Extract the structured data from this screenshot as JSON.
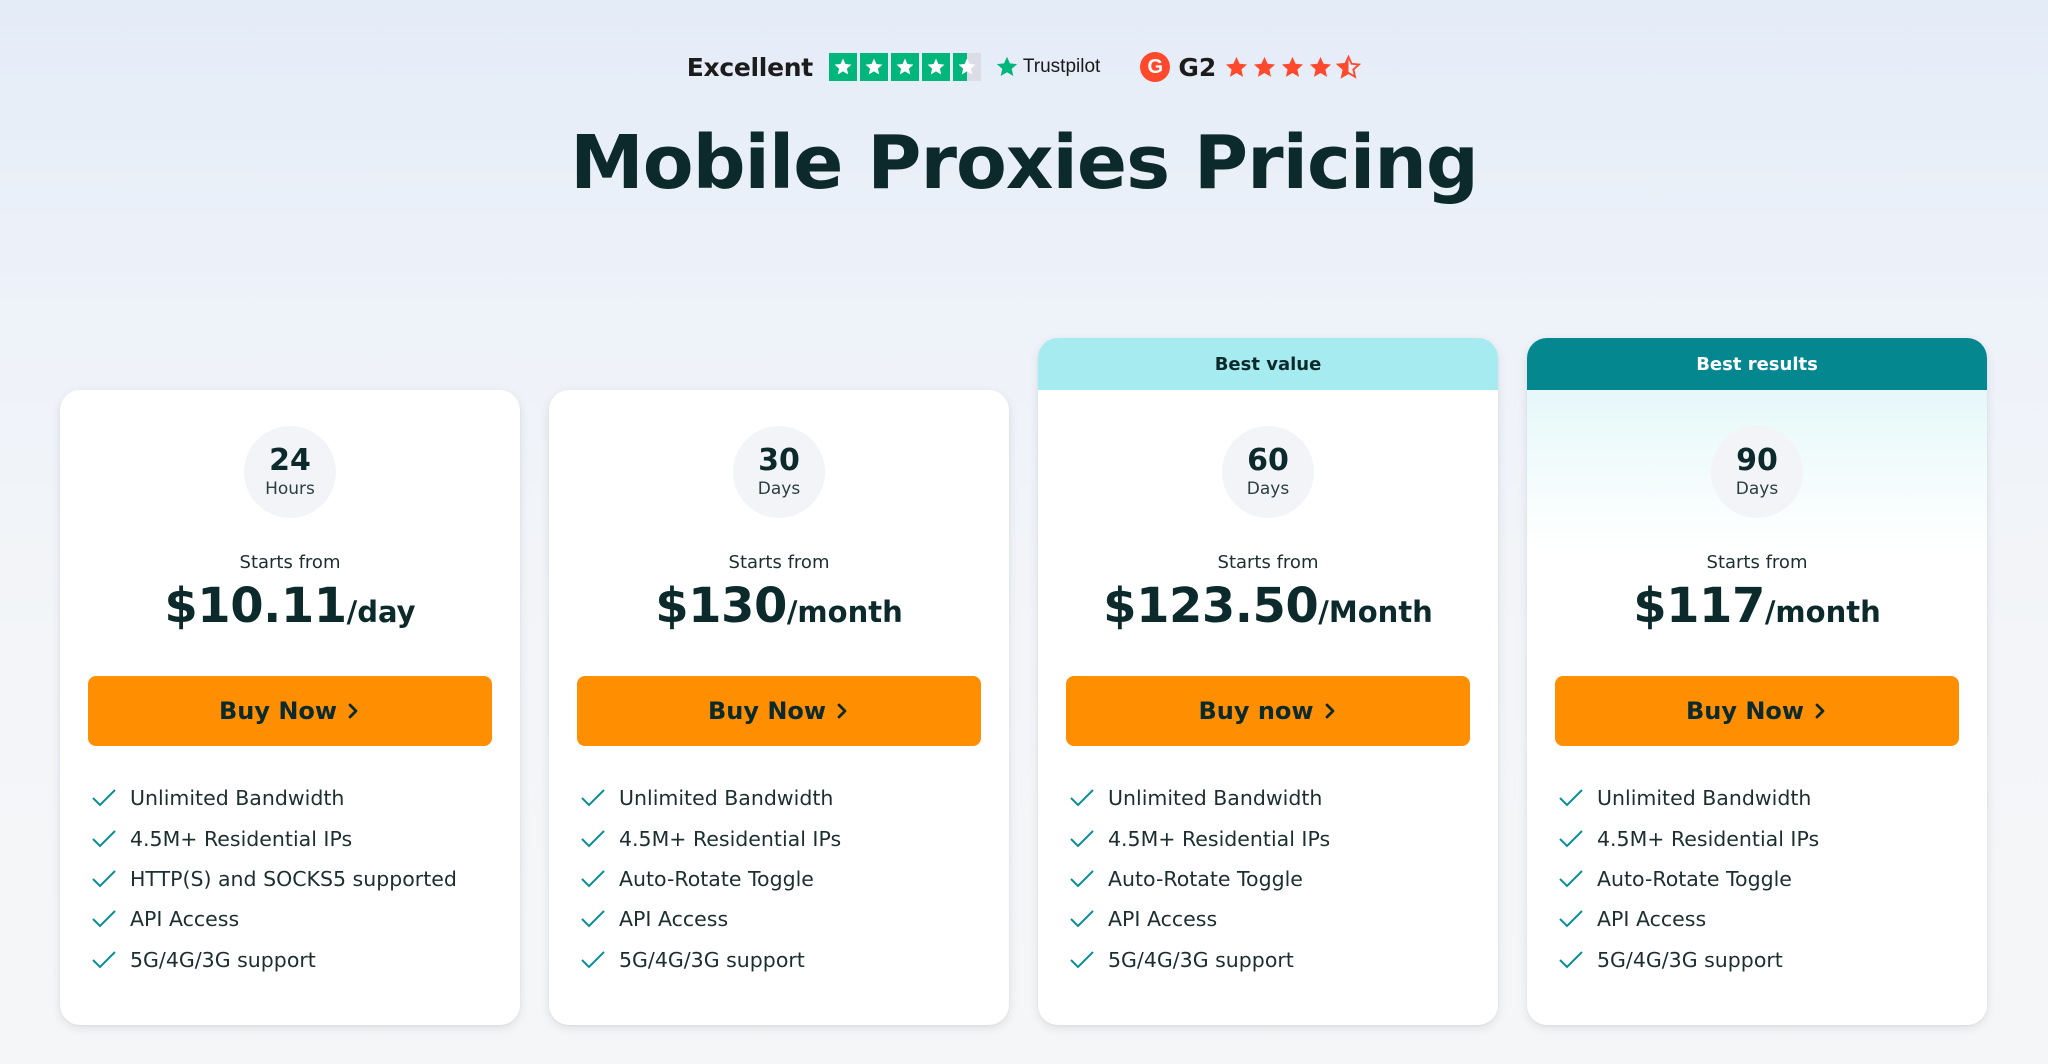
{
  "ratings": {
    "trustpilot_label": "Excellent",
    "trustpilot_brand": "Trustpilot",
    "trustpilot_stars": 4.5,
    "g2_brand": "G2",
    "g2_logo_letter": "G",
    "g2_stars": 4.5
  },
  "title": "Mobile Proxies Pricing",
  "colors": {
    "accent_button": "#ff8f00",
    "best_value_tag": "#a6ebf0",
    "best_results_tag": "#04878f",
    "check": "#0b8e97",
    "trustpilot_green": "#00b67a",
    "g2_red": "#ff492c"
  },
  "plans": [
    {
      "tag": "",
      "duration_value": "24",
      "duration_unit": "Hours",
      "starts_label": "Starts from",
      "price": "$10.11",
      "period": "/day",
      "cta": "Buy Now",
      "cta_icon": "chevron-right-icon",
      "features": [
        "Unlimited Bandwidth",
        "4.5M+ Residential IPs",
        "HTTP(S) and SOCKS5 supported",
        "API Access",
        "5G/4G/3G support"
      ]
    },
    {
      "tag": "",
      "duration_value": "30",
      "duration_unit": "Days",
      "starts_label": "Starts from",
      "price": "$130",
      "period": "/month",
      "cta": "Buy Now",
      "cta_icon": "chevron-right-icon",
      "features": [
        "Unlimited Bandwidth",
        "4.5M+ Residential IPs",
        "Auto-Rotate Toggle",
        "API Access",
        "5G/4G/3G support"
      ]
    },
    {
      "tag": "Best value",
      "duration_value": "60",
      "duration_unit": "Days",
      "starts_label": "Starts from",
      "price": "$123.50",
      "period": "/Month",
      "cta": "Buy now",
      "cta_icon": "chevron-right-icon",
      "features": [
        "Unlimited Bandwidth",
        "4.5M+ Residential IPs",
        "Auto-Rotate Toggle",
        "API Access",
        "5G/4G/3G support"
      ]
    },
    {
      "tag": "Best results",
      "duration_value": "90",
      "duration_unit": "Days",
      "starts_label": "Starts from",
      "price": "$117",
      "period": "/month",
      "cta": "Buy Now",
      "cta_icon": "chevron-right-icon",
      "features": [
        "Unlimited Bandwidth",
        "4.5M+ Residential IPs",
        "Auto-Rotate Toggle",
        "API Access",
        "5G/4G/3G support"
      ]
    }
  ]
}
